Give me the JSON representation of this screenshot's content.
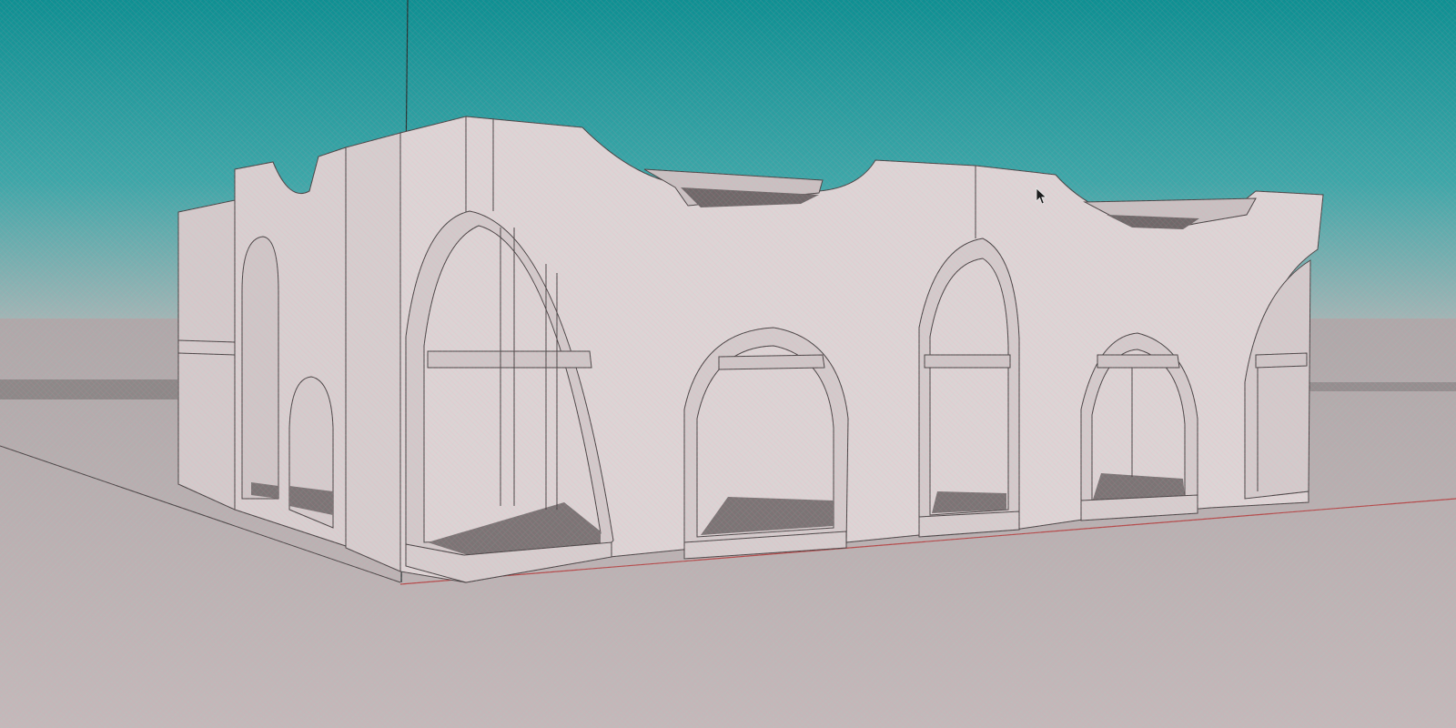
{
  "app": {
    "view": "3d-perspective-model-viewport"
  },
  "colors": {
    "sky_top": "#0f8f92",
    "sky_mid": "#2ea0a0",
    "sky_bottom": "#a9b7b7",
    "ground": "#bdb5b6",
    "ground_far": "#a8a3a4",
    "wall_front": "#ddd4d5",
    "wall_side": "#d2c9ca",
    "wall_shade": "#cbbfc0",
    "edge": "#4b4546",
    "interior_floor": "#7b7475",
    "red_axis": "#c83a3a",
    "green_axis": "#3a8f4a",
    "blue_axis": "#2a3a3a"
  },
  "icons": {
    "cursor": "mouse-pointer-icon"
  }
}
